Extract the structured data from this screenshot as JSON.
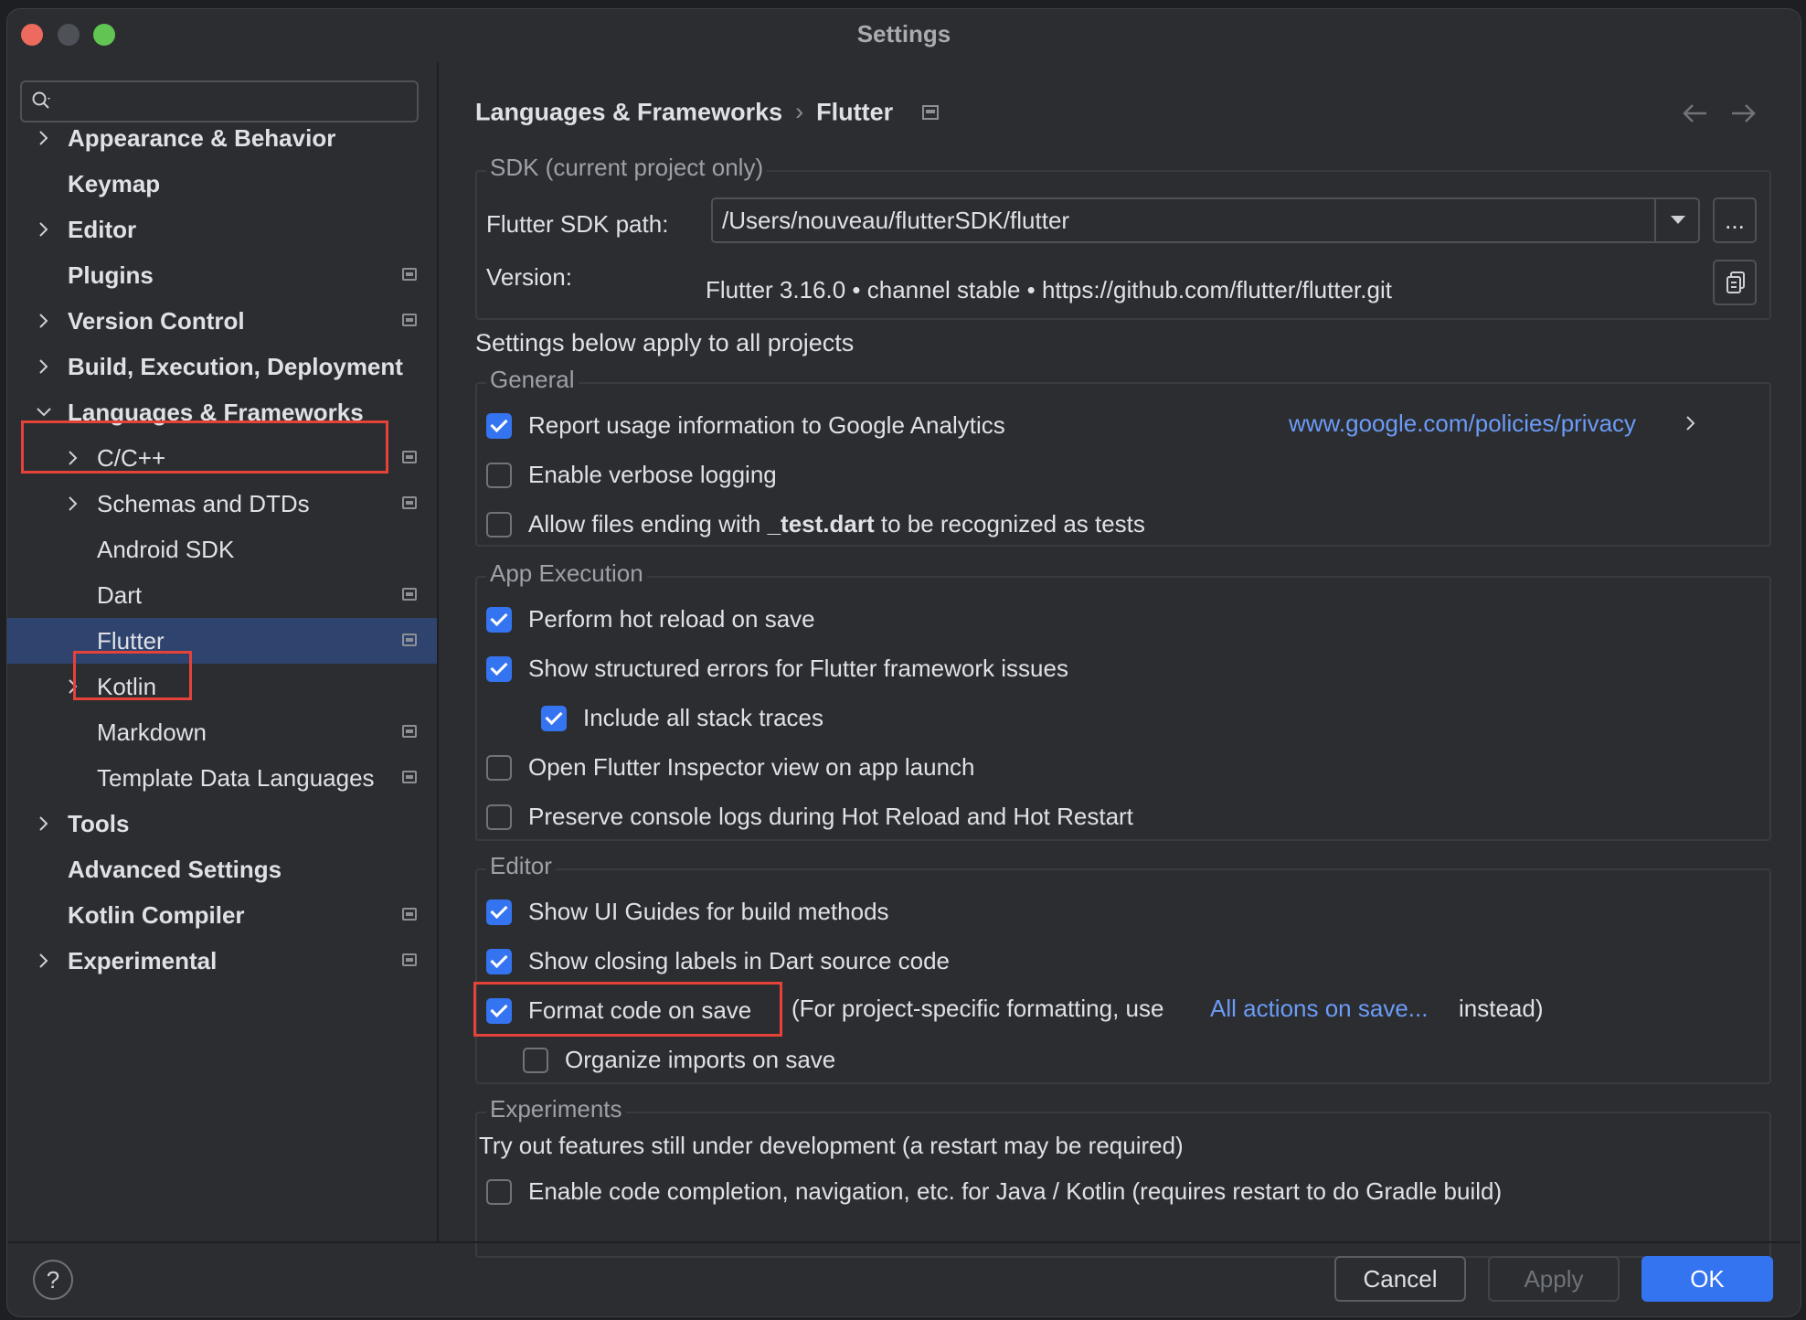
{
  "window": {
    "title": "Settings"
  },
  "sidebar": {
    "search_placeholder": "",
    "items": [
      {
        "label": "Appearance & Behavior"
      },
      {
        "label": "Keymap"
      },
      {
        "label": "Editor"
      },
      {
        "label": "Plugins"
      },
      {
        "label": "Version Control"
      },
      {
        "label": "Build, Execution, Deployment"
      },
      {
        "label": "Languages & Frameworks"
      },
      {
        "label": "C/C++"
      },
      {
        "label": "Schemas and DTDs"
      },
      {
        "label": "Android SDK"
      },
      {
        "label": "Dart"
      },
      {
        "label": "Flutter"
      },
      {
        "label": "Kotlin"
      },
      {
        "label": "Markdown"
      },
      {
        "label": "Template Data Languages"
      },
      {
        "label": "Tools"
      },
      {
        "label": "Advanced Settings"
      },
      {
        "label": "Kotlin Compiler"
      },
      {
        "label": "Experimental"
      }
    ]
  },
  "breadcrumb": {
    "parent": "Languages & Frameworks",
    "separator": "›",
    "current": "Flutter"
  },
  "sdk": {
    "group_title": "SDK (current project only)",
    "path_label": "Flutter SDK path:",
    "path_value": "/Users/nouveau/flutterSDK/flutter",
    "browse_label": "...",
    "version_label": "Version:",
    "version_value": "Flutter 3.16.0 • channel stable • https://github.com/flutter/flutter.git"
  },
  "all_projects_heading": "Settings below apply to all projects",
  "general": {
    "title": "General",
    "report_usage": "Report usage information to Google Analytics",
    "privacy_link": "www.google.com/policies/privacy",
    "verbose_logging": "Enable verbose logging",
    "allow_files_prefix": "Allow files ending with ",
    "allow_files_bold": "_test.dart",
    "allow_files_suffix": " to be recognized as tests"
  },
  "app_execution": {
    "title": "App Execution",
    "hot_reload": "Perform hot reload on save",
    "structured_errors": "Show structured errors for Flutter framework issues",
    "stack_traces": "Include all stack traces",
    "open_inspector": "Open Flutter Inspector view on app launch",
    "preserve_logs": "Preserve console logs during Hot Reload and Hot Restart"
  },
  "editor": {
    "title": "Editor",
    "ui_guides": "Show UI Guides for build methods",
    "closing_labels": "Show closing labels in Dart source code",
    "format_on_save": "Format code on save",
    "format_note_prefix": "(For project-specific formatting, use",
    "format_note_link": "All actions on save...",
    "format_note_suffix": "instead)",
    "organize_imports": "Organize imports on save"
  },
  "experiments": {
    "title": "Experiments",
    "description": "Try out features still under development (a restart may be required)",
    "java_kotlin": "Enable code completion, navigation, etc. for Java / Kotlin (requires restart to do Gradle build)"
  },
  "footer": {
    "help": "?",
    "cancel": "Cancel",
    "apply": "Apply",
    "ok": "OK"
  },
  "colors": {
    "accent": "#3574f0",
    "highlight": "#e5423a",
    "link": "#6c9bf7",
    "selection": "#2e436e"
  }
}
